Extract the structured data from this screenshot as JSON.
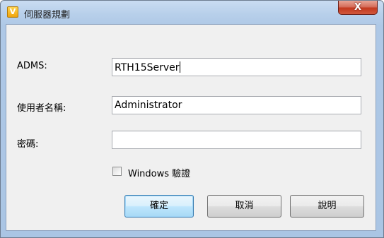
{
  "window": {
    "title": "伺服器規劃",
    "app_icon_letter": "V",
    "close_glyph": "X"
  },
  "form": {
    "adms_label": "ADMS:",
    "adms_value": "RTH15Server",
    "username_label": "使用者名稱:",
    "username_value": "Administrator",
    "password_label": "密碼:",
    "password_value": ""
  },
  "checkbox": {
    "label": "Windows 驗證",
    "checked": false
  },
  "buttons": {
    "ok": "確定",
    "cancel": "取消",
    "help": "說明"
  },
  "icons": {
    "app": "app-logo-icon",
    "close": "close-icon"
  }
}
